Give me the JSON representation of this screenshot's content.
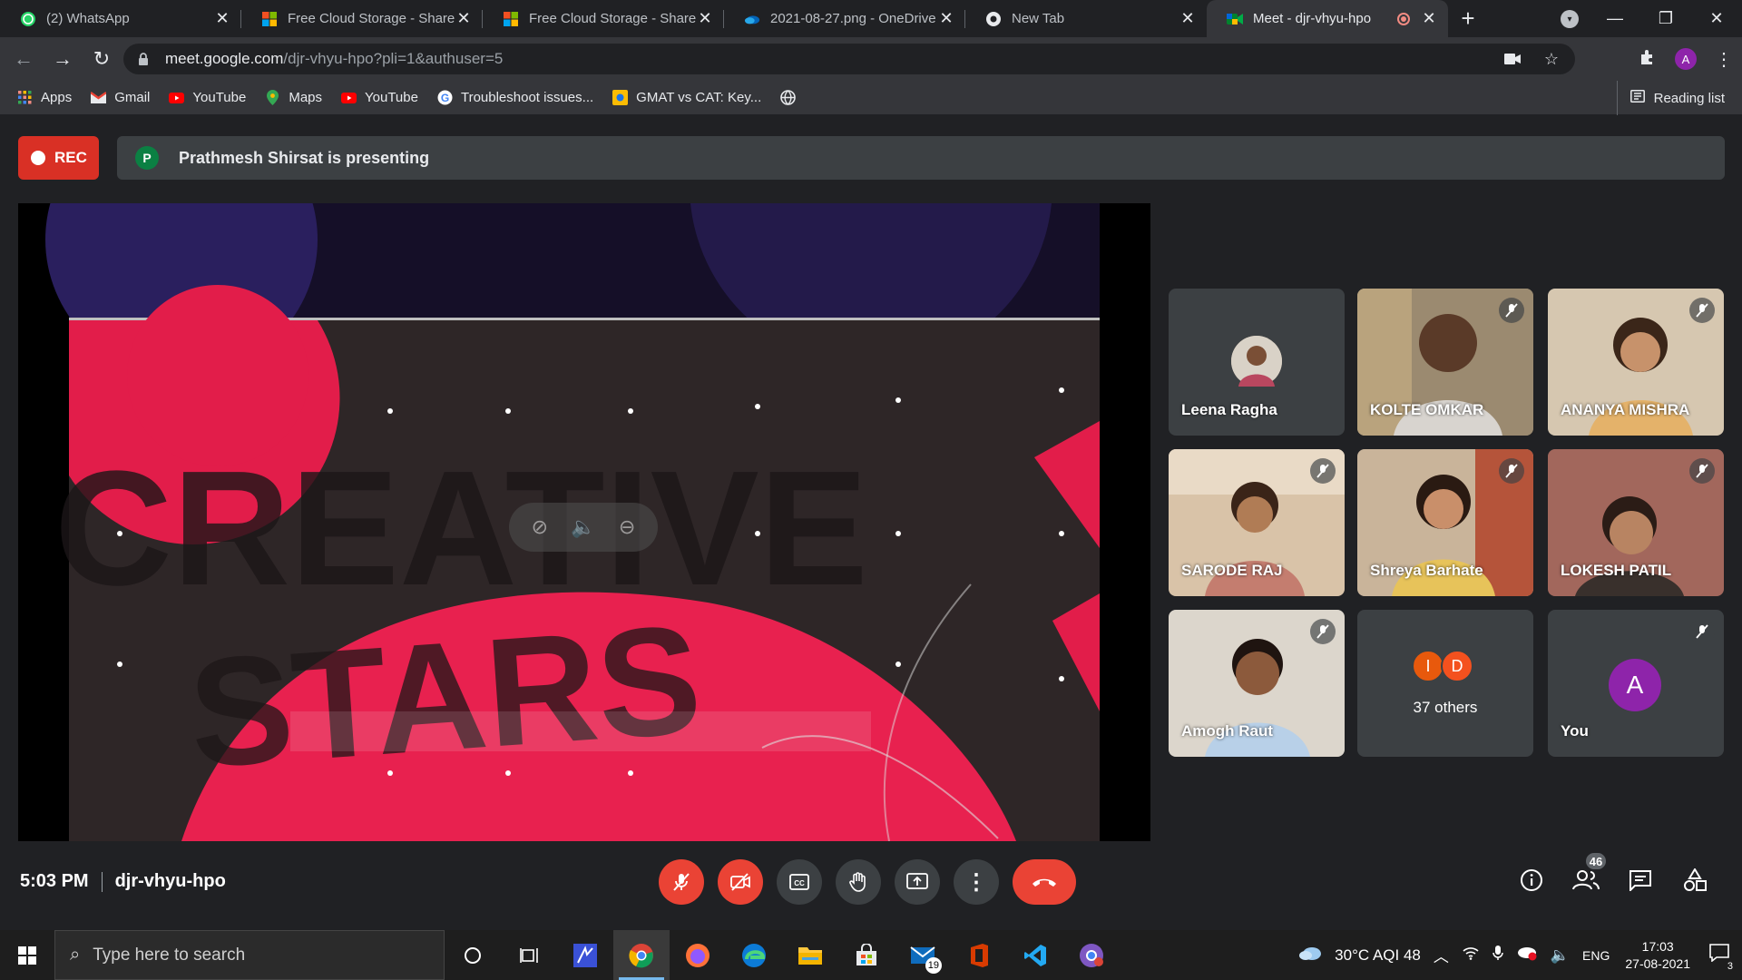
{
  "browser": {
    "tabs": [
      {
        "title": "(2) WhatsApp",
        "icon": "whatsapp-icon",
        "active": false
      },
      {
        "title": "Free Cloud Storage - Share",
        "icon": "microsoft-icon",
        "active": false
      },
      {
        "title": "Free Cloud Storage - Share",
        "icon": "microsoft-icon",
        "active": false
      },
      {
        "title": "2021-08-27.png - OneDrive",
        "icon": "onedrive-icon",
        "active": false
      },
      {
        "title": "New Tab",
        "icon": "chrome-icon",
        "active": false
      },
      {
        "title": "Meet - djr-vhyu-hpo",
        "icon": "meet-icon",
        "active": true
      }
    ],
    "url_host": "meet.google.com",
    "url_path": "/djr-vhyu-hpo?pli=1&authuser=5",
    "profile_initial": "A",
    "bookmarks": [
      "Apps",
      "Gmail",
      "YouTube",
      "Maps",
      "YouTube",
      "Troubleshoot issues...",
      "GMAT vs CAT: Key..."
    ],
    "reading_list": "Reading list"
  },
  "meet": {
    "rec_label": "REC",
    "presenter_initial": "P",
    "presenting_text": "Prathmesh Shirsat is presenting",
    "participants": [
      {
        "name": "Leena Ragha",
        "muted": false
      },
      {
        "name": "KOLTE OMKAR",
        "muted": true
      },
      {
        "name": "ANANYA MISHRA",
        "muted": true
      },
      {
        "name": "SARODE RAJ",
        "muted": true
      },
      {
        "name": "Shreya Barhate",
        "muted": true
      },
      {
        "name": "LOKESH PATIL",
        "muted": true
      },
      {
        "name": "Amogh Raut",
        "muted": true
      }
    ],
    "others": {
      "initials": [
        "I",
        "D"
      ],
      "label": "37 others"
    },
    "self": {
      "initial": "A",
      "label": "You"
    },
    "time": "5:03 PM",
    "meeting_code": "djr-vhyu-hpo",
    "participant_count": "46",
    "colors": {
      "rec": "#d93025",
      "end_call": "#ea4335",
      "self_avatar": "#8e24aa",
      "other_avatar_i": "#e8590c",
      "other_avatar_d": "#f4511e"
    }
  },
  "taskbar": {
    "search_placeholder": "Type here to search",
    "weather": "30°C  AQI 48",
    "language": "ENG",
    "time": "17:03",
    "date": "27-08-2021",
    "mail_badge": "19",
    "notification_count": "3"
  }
}
